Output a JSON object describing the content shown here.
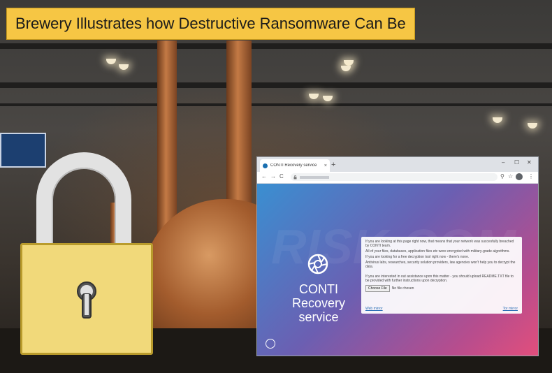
{
  "banner": {
    "title": "Brewery Illustrates how Destructive Ransomware Can Be"
  },
  "browser": {
    "tab_title": "CONTI Recovery service",
    "tab_close": "×",
    "new_tab": "+",
    "window_minimize": "–",
    "window_maximize": "☐",
    "window_close": "✕",
    "back": "←",
    "forward": "→",
    "reload": "C",
    "zoom_icon": "⚲",
    "star_icon": "☆",
    "menu_icon": "⋮"
  },
  "page": {
    "watermark": "RISK.COM",
    "brand_line1": "CONTI",
    "brand_line2": "Recovery",
    "brand_line3": "service",
    "paragraphs": [
      "If you are looking at this page right now, that means that your network was succesfully breached by CONTI team.",
      "All of your files, databases, application files etc were encrypted with military-grade algorithms.",
      "If you are looking for a free decryption tool right now - there's none.",
      "Antivirus labs, researches, security solution providers, law agencies won't help you to decrypt the data.",
      "If you are interested in out assistance upon this matter - you should upload README.TXT file to be provided with further instructions upon decryption."
    ],
    "choose_file_label": "Choose File",
    "no_file_text": "No file chosen",
    "web_mirror": "Web mirror",
    "tor_mirror": "Tor mirror"
  },
  "colors": {
    "banner_bg": "#f6c644",
    "lock_body": "#f1d97a",
    "gradient_start": "#3a8fd1",
    "gradient_end": "#e24e7c"
  }
}
